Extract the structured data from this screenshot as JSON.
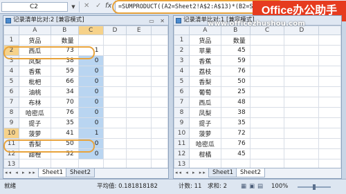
{
  "formula_bar": {
    "name_box": "C2",
    "fx_label": "fx",
    "formula": "=SUMPRODUCT((A2=Sheet2!A$2:A$13)*(B2=Sheet2!B$2:B$13))"
  },
  "logo": {
    "text": "Office办公助手"
  },
  "watermark": "www.officezhushou.com",
  "left_window": {
    "title": "记录清单比对:2 [兼容模式]",
    "col_headers": [
      "A",
      "B",
      "C",
      "D",
      "E"
    ],
    "rows": [
      {
        "n": "1",
        "a": "货品",
        "b": "数量",
        "c": ""
      },
      {
        "n": "2",
        "a": "西瓜",
        "b": "73",
        "c": "1"
      },
      {
        "n": "3",
        "a": "凤梨",
        "b": "38",
        "c": "0"
      },
      {
        "n": "4",
        "a": "香蕉",
        "b": "59",
        "c": "0"
      },
      {
        "n": "5",
        "a": "枇杷",
        "b": "66",
        "c": "0"
      },
      {
        "n": "6",
        "a": "油桃",
        "b": "34",
        "c": "0"
      },
      {
        "n": "7",
        "a": "布林",
        "b": "70",
        "c": "0"
      },
      {
        "n": "8",
        "a": "哈密瓜",
        "b": "76",
        "c": "0"
      },
      {
        "n": "9",
        "a": "提子",
        "b": "35",
        "c": "0"
      },
      {
        "n": "10",
        "a": "菠萝",
        "b": "41",
        "c": "1"
      },
      {
        "n": "11",
        "a": "香梨",
        "b": "50",
        "c": "0"
      },
      {
        "n": "12",
        "a": "甜橙",
        "b": "52",
        "c": "0"
      },
      {
        "n": "13",
        "a": "",
        "b": "",
        "c": ""
      }
    ],
    "tabs": [
      "Sheet1",
      "Sheet2"
    ]
  },
  "right_window": {
    "title": "记录清单比对:1 [兼容模式]",
    "col_headers": [
      "A",
      "B",
      "C",
      "D"
    ],
    "rows": [
      {
        "n": "1",
        "a": "货品",
        "b": "数量"
      },
      {
        "n": "2",
        "a": "苹果",
        "b": "45"
      },
      {
        "n": "3",
        "a": "香蕉",
        "b": "59"
      },
      {
        "n": "4",
        "a": "荔枝",
        "b": "76"
      },
      {
        "n": "5",
        "a": "香梨",
        "b": "50"
      },
      {
        "n": "6",
        "a": "葡萄",
        "b": "25"
      },
      {
        "n": "7",
        "a": "西瓜",
        "b": "48"
      },
      {
        "n": "8",
        "a": "凤梨",
        "b": "38"
      },
      {
        "n": "9",
        "a": "提子",
        "b": "35"
      },
      {
        "n": "10",
        "a": "菠萝",
        "b": "72"
      },
      {
        "n": "11",
        "a": "哈密瓜",
        "b": "76"
      },
      {
        "n": "12",
        "a": "柑橘",
        "b": "45"
      },
      {
        "n": "13",
        "a": "",
        "b": ""
      }
    ],
    "tabs": [
      "Sheet1",
      "Sheet2"
    ]
  },
  "status_bar": {
    "ready": "就绪",
    "average": "平均值: 0.181818182",
    "count": "计数: 11",
    "sum": "求和: 2",
    "zoom": "100%"
  },
  "colors": {
    "highlight": "#e8a33b",
    "selection": "#b9d5f1",
    "logo_bg": "#e63b1f"
  }
}
